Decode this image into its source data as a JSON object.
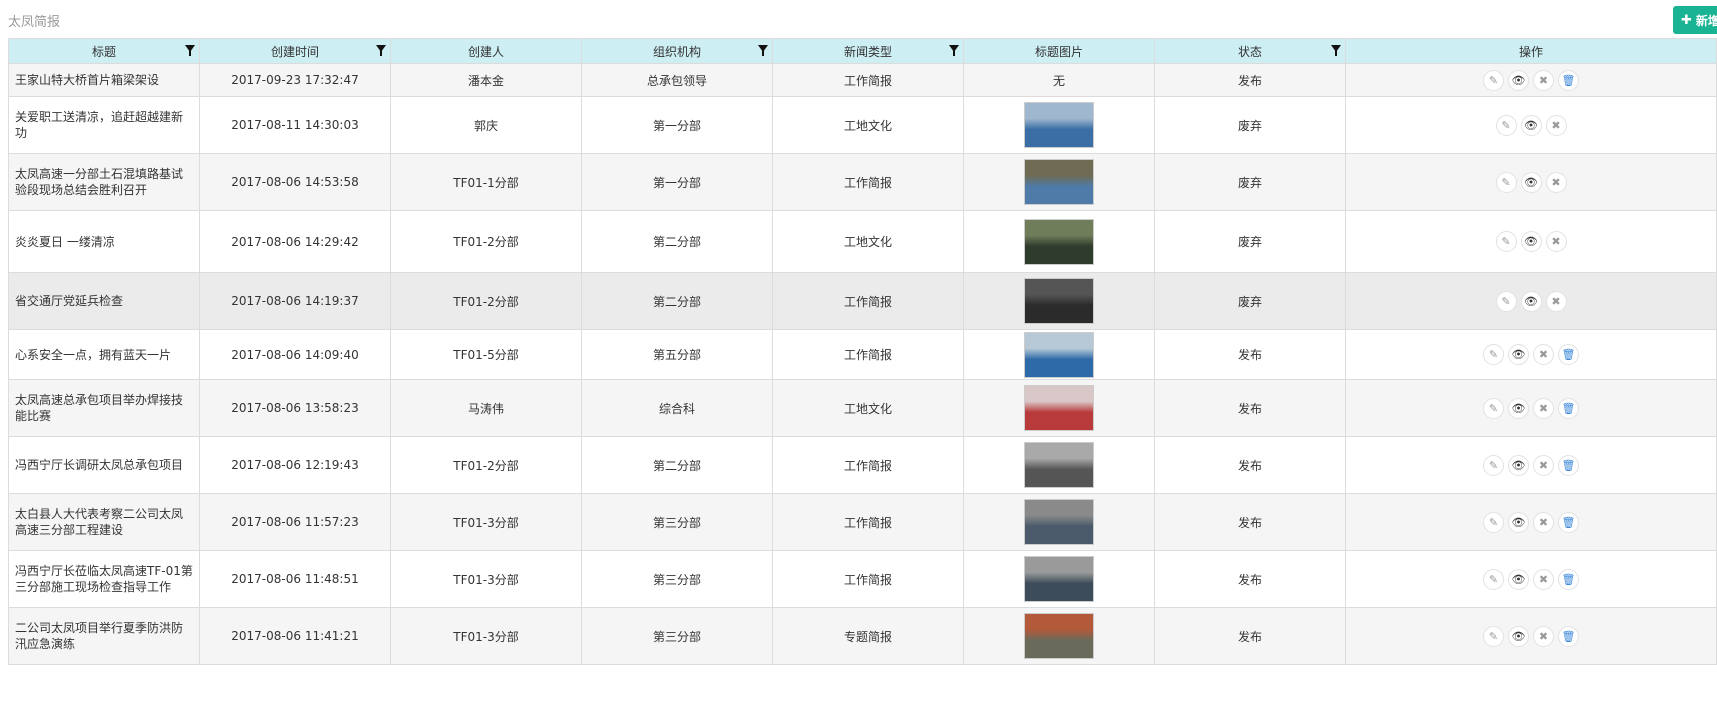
{
  "page": {
    "title": "太凤简报",
    "add_button": "新增"
  },
  "columns": [
    "标题",
    "创建时间",
    "创建人",
    "组织机构",
    "新闻类型",
    "标题图片",
    "状态",
    "操作"
  ],
  "colors": {
    "header_bg": "#cdeef3",
    "accent": "#1ab394",
    "delete": "#3a86d9"
  },
  "rows": [
    {
      "title": "王家山特大桥首片箱梁架设",
      "time": "2017-09-23 17:32:47",
      "creator": "潘本金",
      "org": "总承包领导",
      "type": "工作简报",
      "image": "无",
      "status": "发布",
      "ops": [
        "edit",
        "view",
        "close",
        "delete"
      ]
    },
    {
      "title": "关爱职工送清凉，追赶超越建新功",
      "time": "2017-08-11 14:30:03",
      "creator": "郭庆",
      "org": "第一分部",
      "type": "工地文化",
      "image": "photo",
      "status": "废弃",
      "ops": [
        "edit",
        "view",
        "close"
      ]
    },
    {
      "title": "太凤高速一分部土石混填路基试验段现场总结会胜利召开",
      "time": "2017-08-06 14:53:58",
      "creator": "TF01-1分部",
      "org": "第一分部",
      "type": "工作简报",
      "image": "photo",
      "status": "废弃",
      "ops": [
        "edit",
        "view",
        "close"
      ]
    },
    {
      "title": "炎炎夏日 一缕清凉",
      "time": "2017-08-06 14:29:42",
      "creator": "TF01-2分部",
      "org": "第二分部",
      "type": "工地文化",
      "image": "photo",
      "status": "废弃",
      "ops": [
        "edit",
        "view",
        "close"
      ]
    },
    {
      "title": "省交通厅党延兵检查",
      "time": "2017-08-06 14:19:37",
      "creator": "TF01-2分部",
      "org": "第二分部",
      "type": "工作简报",
      "image": "photo",
      "status": "废弃",
      "ops": [
        "edit",
        "view",
        "close"
      ]
    },
    {
      "title": "心系安全一点，拥有蓝天一片",
      "time": "2017-08-06 14:09:40",
      "creator": "TF01-5分部",
      "org": "第五分部",
      "type": "工作简报",
      "image": "photo",
      "status": "发布",
      "ops": [
        "edit",
        "view",
        "close",
        "delete"
      ]
    },
    {
      "title": "太凤高速总承包项目举办焊接技能比赛",
      "time": "2017-08-06 13:58:23",
      "creator": "马涛伟",
      "org": "综合科",
      "type": "工地文化",
      "image": "photo",
      "status": "发布",
      "ops": [
        "edit",
        "view",
        "close",
        "delete"
      ]
    },
    {
      "title": "冯西宁厅长调研太凤总承包项目",
      "time": "2017-08-06 12:19:43",
      "creator": "TF01-2分部",
      "org": "第二分部",
      "type": "工作简报",
      "image": "photo",
      "status": "发布",
      "ops": [
        "edit",
        "view",
        "close",
        "delete"
      ]
    },
    {
      "title": "太白县人大代表考察二公司太凤高速三分部工程建设",
      "time": "2017-08-06 11:57:23",
      "creator": "TF01-3分部",
      "org": "第三分部",
      "type": "工作简报",
      "image": "photo",
      "status": "发布",
      "ops": [
        "edit",
        "view",
        "close",
        "delete"
      ]
    },
    {
      "title": "冯西宁厅长莅临太凤高速TF-01第三分部施工现场检查指导工作",
      "time": "2017-08-06 11:48:51",
      "creator": "TF01-3分部",
      "org": "第三分部",
      "type": "工作简报",
      "image": "photo",
      "status": "发布",
      "ops": [
        "edit",
        "view",
        "close",
        "delete"
      ]
    },
    {
      "title": "二公司太凤项目举行夏季防洪防汛应急演练",
      "time": "2017-08-06 11:41:21",
      "creator": "TF01-3分部",
      "org": "第三分部",
      "type": "专题简报",
      "image": "photo",
      "status": "发布",
      "ops": [
        "edit",
        "view",
        "close",
        "delete"
      ]
    }
  ]
}
